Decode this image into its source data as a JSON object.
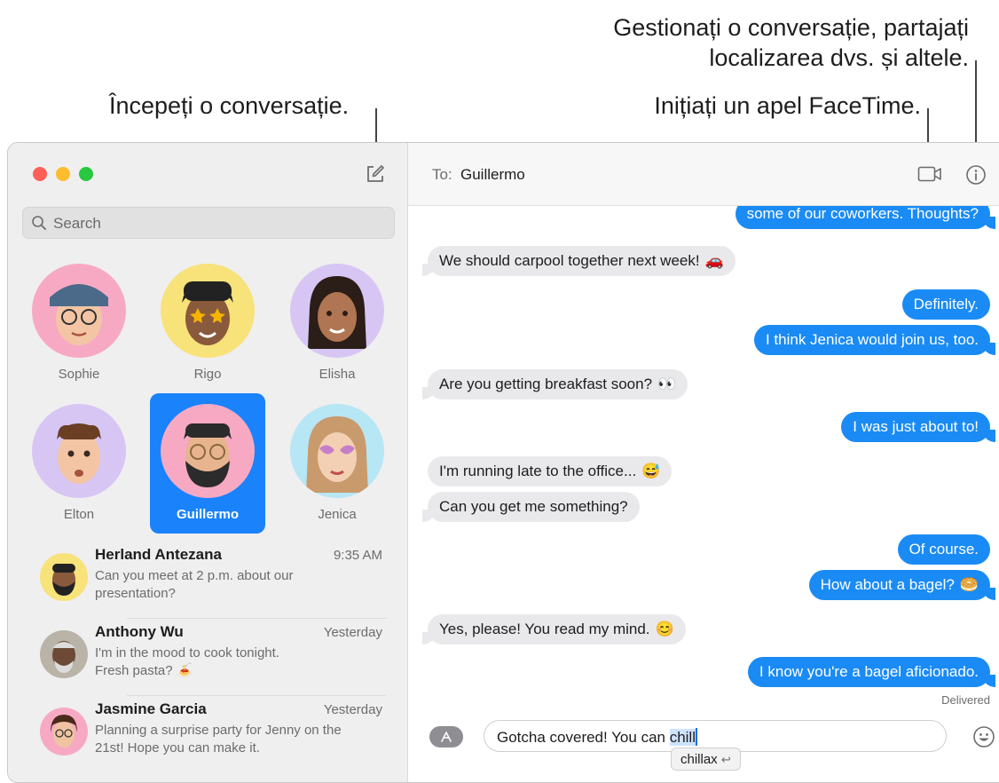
{
  "callouts": {
    "manage_line1": "Gestionați o conversație, partajați",
    "manage_line2": "localizarea dvs. și altele.",
    "facetime": "Inițiați un apel FaceTime.",
    "new_conversation": "Începeți o conversație."
  },
  "sidebar": {
    "search_placeholder": "Search",
    "pins": [
      {
        "name": "Sophie",
        "bg": "#f7a9c4"
      },
      {
        "name": "Rigo",
        "bg": "#f8e27a"
      },
      {
        "name": "Elisha",
        "bg": "#d7c6f3"
      },
      {
        "name": "Elton",
        "bg": "#d7c6f3"
      },
      {
        "name": "Guillermo",
        "bg": "#f7a9c4",
        "selected": true
      },
      {
        "name": "Jenica",
        "bg": "#b7e6f5"
      }
    ],
    "conversations": [
      {
        "name": "Herland Antezana",
        "time": "9:35 AM",
        "preview": "Can you meet at 2 p.m. about our\npresentation?"
      },
      {
        "name": "Anthony Wu",
        "time": "Yesterday",
        "preview": "I'm in the mood to cook tonight.\nFresh pasta? 🍝"
      },
      {
        "name": "Jasmine Garcia",
        "time": "Yesterday",
        "preview": "Planning a surprise party for Jenny on the\n21st! Hope you can make it."
      }
    ]
  },
  "header": {
    "to_label": "To:",
    "recipient": "Guillermo"
  },
  "messages": [
    {
      "dir": "out",
      "text": "some of our coworkers. Thoughts?",
      "emoji": ""
    },
    {
      "dir": "in",
      "text": "We should carpool together next week!",
      "emoji": "🚗"
    },
    {
      "dir": "out",
      "text": "Definitely.",
      "emoji": ""
    },
    {
      "dir": "out",
      "text": "I think Jenica would join us, too.",
      "emoji": ""
    },
    {
      "dir": "in",
      "text": "Are you getting breakfast soon?",
      "emoji": "👀"
    },
    {
      "dir": "out",
      "text": "I was just about to!",
      "emoji": ""
    },
    {
      "dir": "in",
      "text": "I'm running late to the office...",
      "emoji": "😅"
    },
    {
      "dir": "in",
      "text": "Can you get me something?",
      "emoji": ""
    },
    {
      "dir": "out",
      "text": "Of course.",
      "emoji": ""
    },
    {
      "dir": "out",
      "text": "How about a bagel?",
      "emoji": "🥯"
    },
    {
      "dir": "in",
      "text": "Yes, please! You read my mind.",
      "emoji": "😊"
    },
    {
      "dir": "out",
      "text": "I know you're a bagel aficionado.",
      "emoji": ""
    }
  ],
  "status": {
    "delivered": "Delivered"
  },
  "composer": {
    "text_before": "Gotcha covered! You can ",
    "text_selected": "chill",
    "suggestion": "chillax"
  },
  "colors": {
    "accent": "#1a82fb",
    "outgoing_bubble": "#1a8bf5",
    "incoming_bubble": "#e9e9eb",
    "traffic_red": "#fe5f57",
    "traffic_yellow": "#febc2e",
    "traffic_green": "#28c840"
  }
}
